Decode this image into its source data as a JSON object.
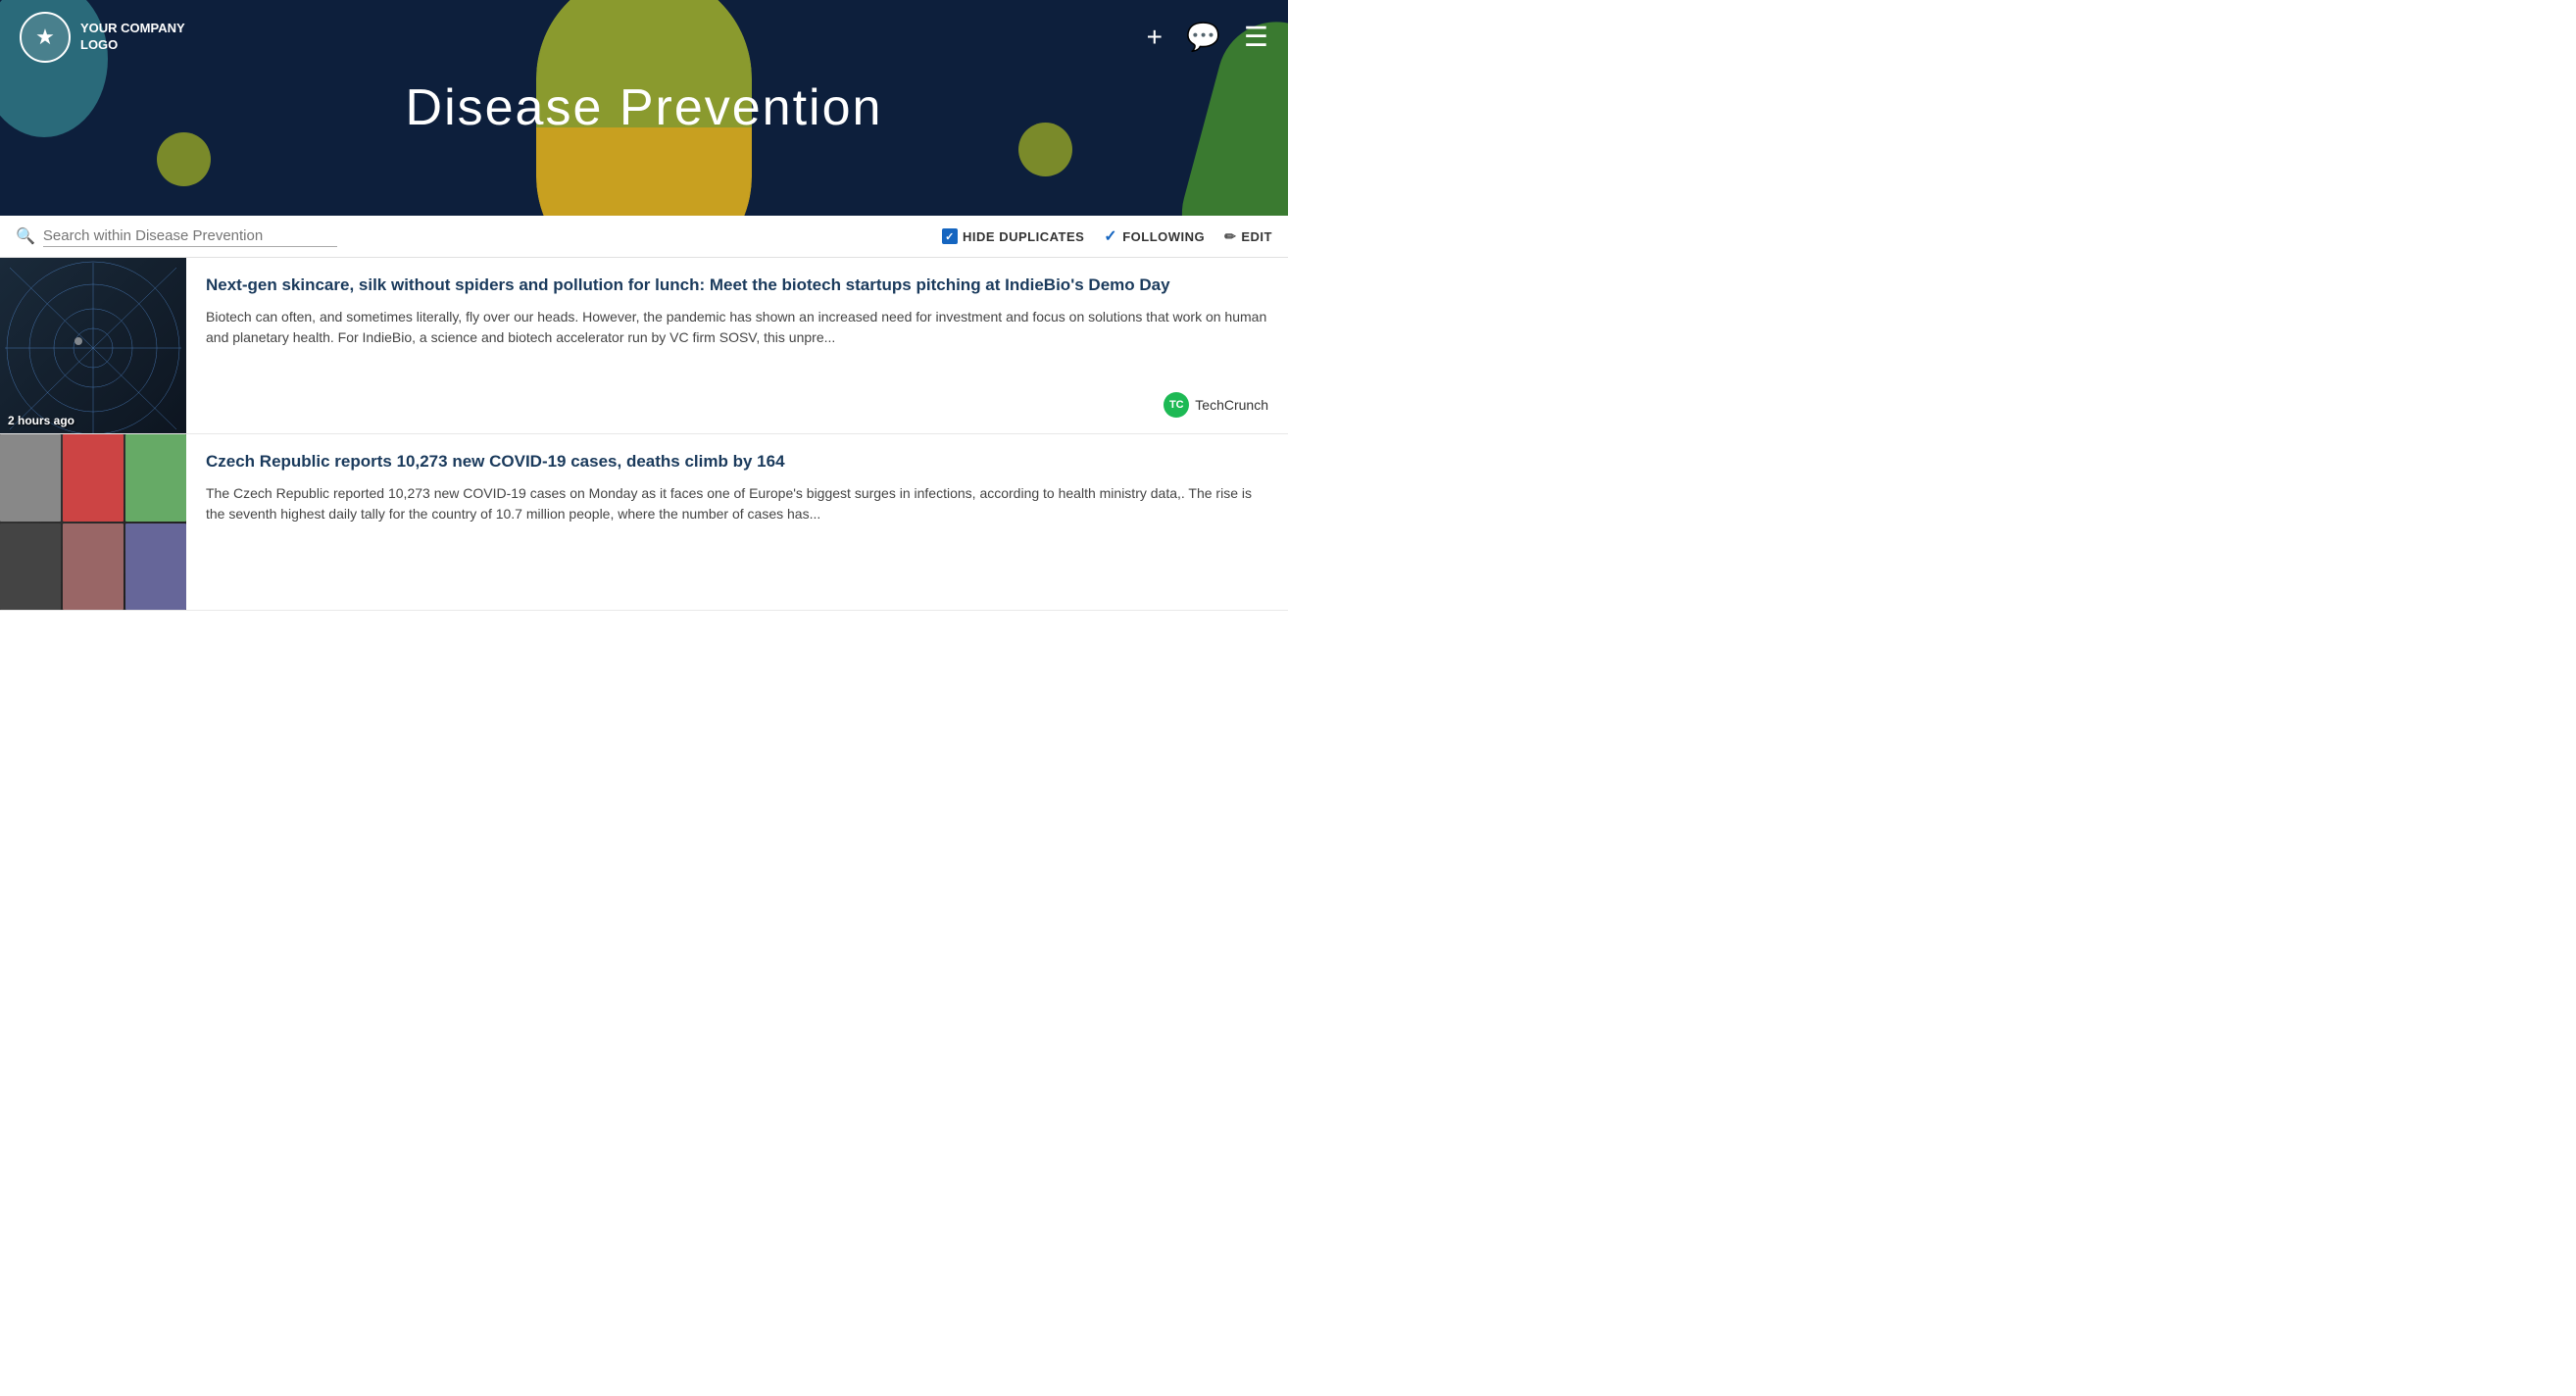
{
  "hero": {
    "title": "Disease Prevention",
    "background_color": "#0d1f3c"
  },
  "logo": {
    "company_line1": "YOUR COMPANY",
    "company_line2": "LOGO",
    "icon": "★"
  },
  "nav": {
    "add_icon": "+",
    "chat_icon": "💬",
    "menu_icon": "☰"
  },
  "toolbar": {
    "search_placeholder": "Search within Disease Prevention",
    "hide_duplicates_label": "HIDE DUPLICATES",
    "following_label": "FOLLOWING",
    "edit_label": "EDIT"
  },
  "articles": [
    {
      "id": 1,
      "headline": "Next-gen skincare, silk without spiders and pollution for lunch: Meet the biotech startups pitching at IndieBio's Demo Day",
      "excerpt": "Biotech can often, and sometimes literally, fly over our heads. However, the pandemic has shown an increased need for investment and focus on solutions that work on human and planetary health. For IndieBio, a science and biotech accelerator run by VC firm SOSV, this unpre...",
      "time_ago": "2 hours ago",
      "source_name": "TechCrunch",
      "source_initials": "TC",
      "source_color": "#1a8c3a"
    },
    {
      "id": 2,
      "headline": "Czech Republic reports 10,273 new COVID-19 cases, deaths climb by 164",
      "excerpt": "The Czech Republic reported 10,273 new COVID-19 cases on Monday as it faces one of Europe's biggest surges in infections, according to health ministry data,. The rise is the seventh highest daily tally for the country of 10.7 million people, where the number of cases has...",
      "time_ago": "",
      "source_name": "",
      "source_initials": "",
      "source_color": ""
    }
  ]
}
